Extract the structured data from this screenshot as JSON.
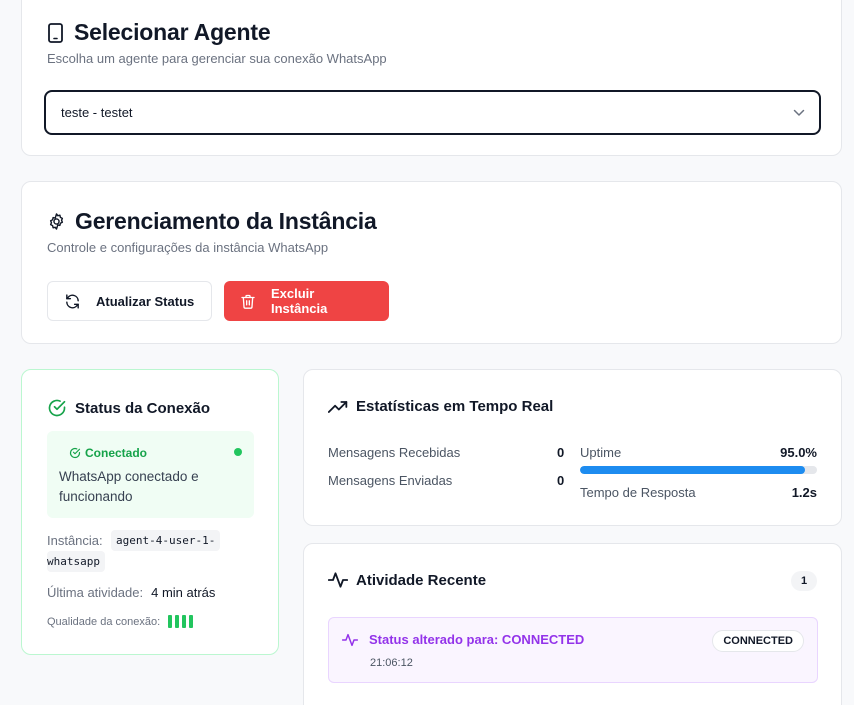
{
  "agent_card": {
    "title": "Selecionar Agente",
    "subtitle": "Escolha um agente para gerenciar sua conexão WhatsApp",
    "selected_agent": "teste - testet"
  },
  "instance_card": {
    "title": "Gerenciamento da Instância",
    "subtitle": "Controle e configurações da instância WhatsApp",
    "refresh_label": "Atualizar Status",
    "delete_label": "Excluir Instância"
  },
  "status_card": {
    "title": "Status da Conexão",
    "badge": "Conectado",
    "message": "WhatsApp conectado e funcionando",
    "instance_label": "Instância:",
    "instance_value_1": "agent-4-user-1-",
    "instance_value_2": "whatsapp",
    "last_activity_label": "Última atividade:",
    "last_activity_value": "4 min atrás",
    "quality_label": "Qualidade da conexão:",
    "quality_level": 4,
    "quality_max": 4
  },
  "stats_card": {
    "title": "Estatísticas em Tempo Real",
    "received_label": "Mensagens Recebidas",
    "received_value": "0",
    "sent_label": "Mensagens Enviadas",
    "sent_value": "0",
    "uptime_label": "Uptime",
    "uptime_value": "95.0%",
    "uptime_fraction": 0.95,
    "response_label": "Tempo de Resposta",
    "response_value": "1.2s"
  },
  "activity_card": {
    "title": "Atividade Recente",
    "count": "1",
    "items": [
      {
        "text": "Status alterado para: CONNECTED",
        "time": "21:06:12",
        "badge": "CONNECTED"
      }
    ]
  },
  "colors": {
    "success": "#22c55e",
    "danger": "#ef4444",
    "progress": "#1d8cf0",
    "activity": "#9333ea"
  }
}
